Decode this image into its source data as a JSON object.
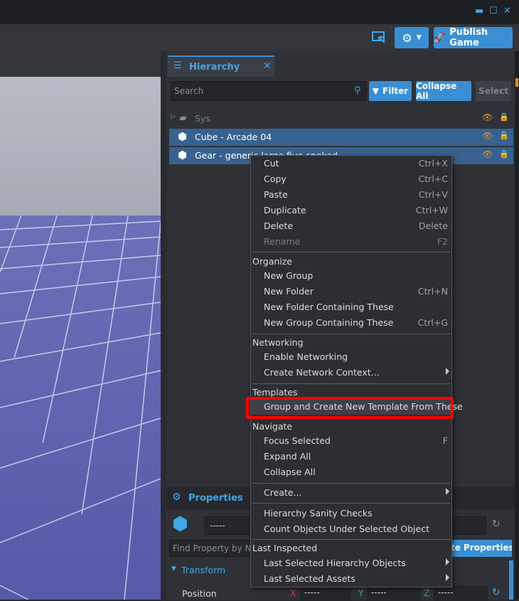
{
  "window_controls": [
    "▬",
    "☐",
    "✕"
  ],
  "toolbar": {
    "publish_label": "Publish Game"
  },
  "hierarchy": {
    "tab_label": "Hierarchy",
    "tab_close": "✕",
    "search_placeholder": "Search",
    "filter_label": "Filter",
    "collapse_all_label": "Collapse All",
    "select_label": "Select",
    "items": [
      {
        "label": "Sys"
      },
      {
        "label": "Cube - Arcade 04"
      },
      {
        "label": "Gear - generic large five-spoked"
      }
    ]
  },
  "properties": {
    "tab_label": "Properties",
    "name_value": "-----",
    "find_placeholder": "Find Property by Na",
    "button_partial": "te Properties",
    "transform_label": "Transform",
    "position_label": "Position",
    "x_label": "X",
    "y_label": "Y",
    "z_label": "Z",
    "x_value": "-----",
    "y_value": "-----",
    "z_value": "-----"
  },
  "context_menu": {
    "items": [
      {
        "label": "Cut",
        "shortcut": "Ctrl+X"
      },
      {
        "label": "Copy",
        "shortcut": "Ctrl+C"
      },
      {
        "label": "Paste",
        "shortcut": "Ctrl+V"
      },
      {
        "label": "Duplicate",
        "shortcut": "Ctrl+W"
      },
      {
        "label": "Delete",
        "shortcut": "Delete"
      },
      {
        "label": "Rename",
        "shortcut": "F2"
      },
      {
        "label": "New Group",
        "shortcut": ""
      },
      {
        "label": "New Folder",
        "shortcut": "Ctrl+N"
      },
      {
        "label": "New Folder Containing These",
        "shortcut": ""
      },
      {
        "label": "New Group Containing These",
        "shortcut": "Ctrl+G"
      },
      {
        "label": "Enable Networking",
        "shortcut": ""
      },
      {
        "label": "Create Network Context...",
        "shortcut": ""
      },
      {
        "label": "Group and Create New Template From These",
        "shortcut": ""
      },
      {
        "label": "Focus Selected",
        "shortcut": "F"
      },
      {
        "label": "Expand All",
        "shortcut": ""
      },
      {
        "label": "Collapse All",
        "shortcut": ""
      },
      {
        "label": "Create...",
        "shortcut": ""
      },
      {
        "label": "Hierarchy Sanity Checks",
        "shortcut": ""
      },
      {
        "label": "Count Objects Under Selected Object",
        "shortcut": ""
      },
      {
        "label": "Last Selected Hierarchy Objects",
        "shortcut": ""
      },
      {
        "label": "Last Selected Assets",
        "shortcut": ""
      }
    ],
    "headers": {
      "organize": "Organize",
      "networking": "Networking",
      "templates": "Templates",
      "navigate": "Navigate",
      "last_inspected": "Last Inspected"
    }
  },
  "colors": {
    "accent": "#3a8fd4",
    "highlight": "#ff0000",
    "selection": "#37628f",
    "eye": "#e88a2a"
  }
}
